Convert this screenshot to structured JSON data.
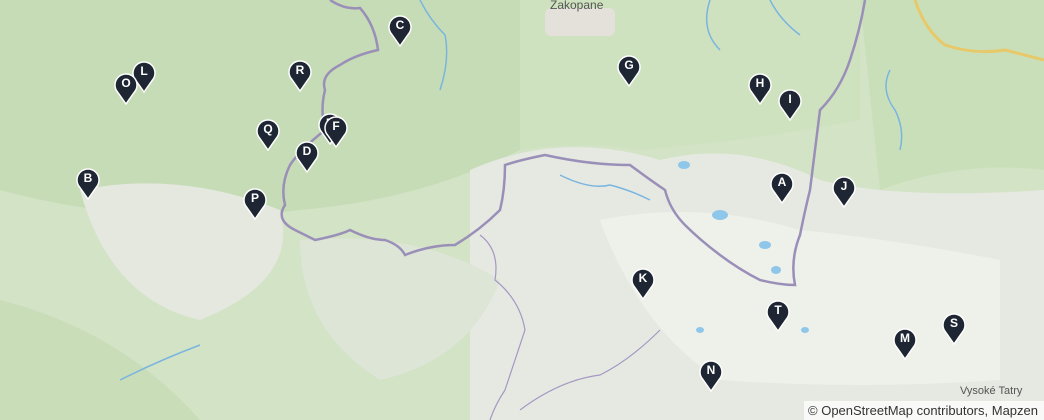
{
  "colors": {
    "forest": "#c7ddb8",
    "mountain": "#eaece6",
    "border": "#9a8fb8",
    "river": "#7ab5e0",
    "lake": "#8fc7ea",
    "road": "#e8c96a",
    "marker_fill": "#1f2633"
  },
  "places": {
    "zakopane": "Zakopane",
    "vysoke_tatry": "Vysoké Tatry"
  },
  "attribution": {
    "text": "© OpenStreetMap contributors, Mapzen"
  },
  "markers": [
    {
      "label": "A",
      "icon": "map-pin-icon"
    },
    {
      "label": "B",
      "icon": "map-pin-icon"
    },
    {
      "label": "C",
      "icon": "map-pin-icon"
    },
    {
      "label": "D",
      "icon": "map-pin-icon"
    },
    {
      "label": "E",
      "icon": "map-pin-icon"
    },
    {
      "label": "F",
      "icon": "map-pin-icon"
    },
    {
      "label": "G",
      "icon": "map-pin-icon"
    },
    {
      "label": "H",
      "icon": "map-pin-icon"
    },
    {
      "label": "I",
      "icon": "map-pin-icon"
    },
    {
      "label": "J",
      "icon": "map-pin-icon"
    },
    {
      "label": "K",
      "icon": "map-pin-icon"
    },
    {
      "label": "L",
      "icon": "map-pin-icon"
    },
    {
      "label": "M",
      "icon": "map-pin-icon"
    },
    {
      "label": "N",
      "icon": "map-pin-icon"
    },
    {
      "label": "O",
      "icon": "map-pin-icon"
    },
    {
      "label": "P",
      "icon": "map-pin-icon"
    },
    {
      "label": "Q",
      "icon": "map-pin-icon"
    },
    {
      "label": "R",
      "icon": "map-pin-icon"
    },
    {
      "label": "S",
      "icon": "map-pin-icon"
    },
    {
      "label": "T",
      "icon": "map-pin-icon"
    }
  ]
}
